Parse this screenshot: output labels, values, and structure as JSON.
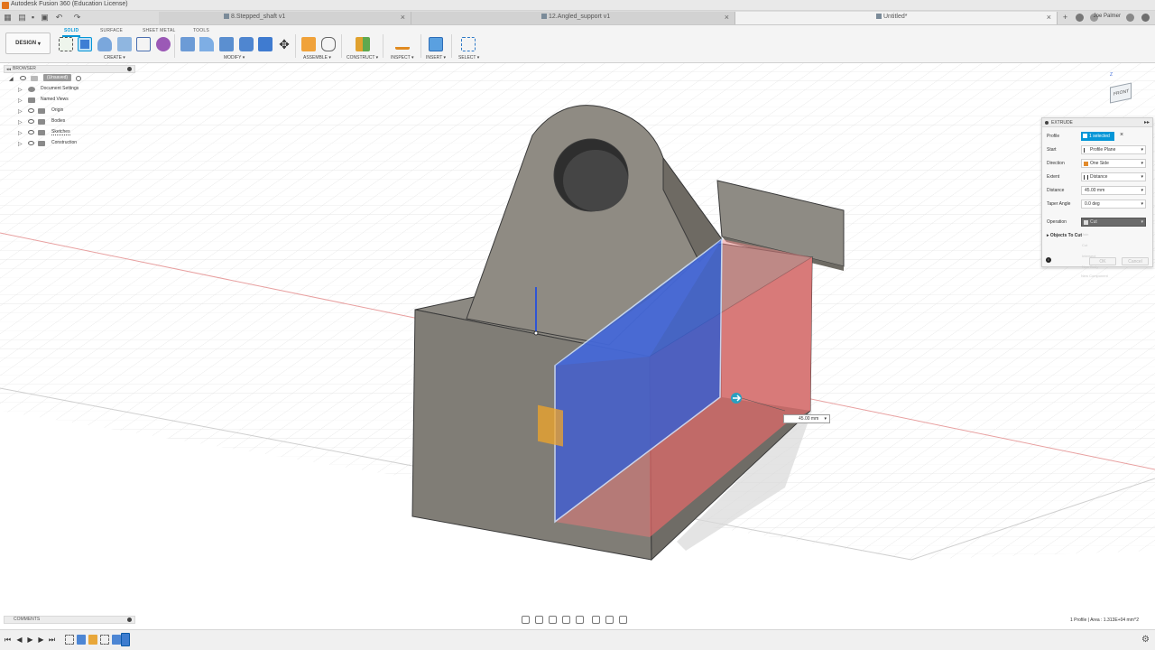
{
  "window": {
    "title": "Autodesk Fusion 360 (Education License)"
  },
  "tabs": [
    {
      "label": "8.Stepped_shaft v1",
      "active": false
    },
    {
      "label": "12.Angled_support v1",
      "active": false
    },
    {
      "label": "Untitled*",
      "active": true
    }
  ],
  "user": {
    "name": "Joe Palmer"
  },
  "toolbar": {
    "workspace_button": "DESIGN",
    "workspace_tabs": [
      "SOLID",
      "SURFACE",
      "SHEET METAL",
      "TOOLS"
    ],
    "groups": {
      "create": "CREATE",
      "modify": "MODIFY",
      "assemble": "ASSEMBLE",
      "construct": "CONSTRUCT",
      "inspect": "INSPECT",
      "insert": "INSERT",
      "select": "SELECT"
    }
  },
  "browser": {
    "header": "BROWSER",
    "root": "(Unsaved)",
    "items": [
      "Document Settings",
      "Named Views",
      "Origin",
      "Bodies",
      "Sketches",
      "Construction"
    ]
  },
  "viewcube": {
    "face_label": "FRONT",
    "axis_label": "Z"
  },
  "extrude_panel": {
    "title": "EXTRUDE",
    "rows": {
      "profile": {
        "label": "Profile",
        "value": "1 selected"
      },
      "start": {
        "label": "Start",
        "value": "Profile Plane"
      },
      "direction": {
        "label": "Direction",
        "value": "One Side"
      },
      "extent": {
        "label": "Extent",
        "value": "Distance"
      },
      "distance": {
        "label": "Distance",
        "value": "45.00 mm"
      },
      "taper": {
        "label": "Taper Angle",
        "value": "0.0 deg"
      },
      "operation": {
        "label": "Operation",
        "value": "Cut"
      }
    },
    "objects_to_cut": "Objects To Cut",
    "operation_options": [
      "Join",
      "Cut",
      "Intersect",
      "New Body",
      "New Component"
    ],
    "ok_label": "OK",
    "cancel_label": "Cancel"
  },
  "dimension_input": {
    "value": "45.00 mm"
  },
  "comments": {
    "label": "COMMENTS"
  },
  "status_bar": {
    "text": "1 Profile | Area : 1.313E+04 mm^2"
  },
  "colors": {
    "accent": "#0696d7",
    "body": "#807d76",
    "cut_preview": "#e46a6a",
    "profile_face": "#3a5fcf"
  }
}
